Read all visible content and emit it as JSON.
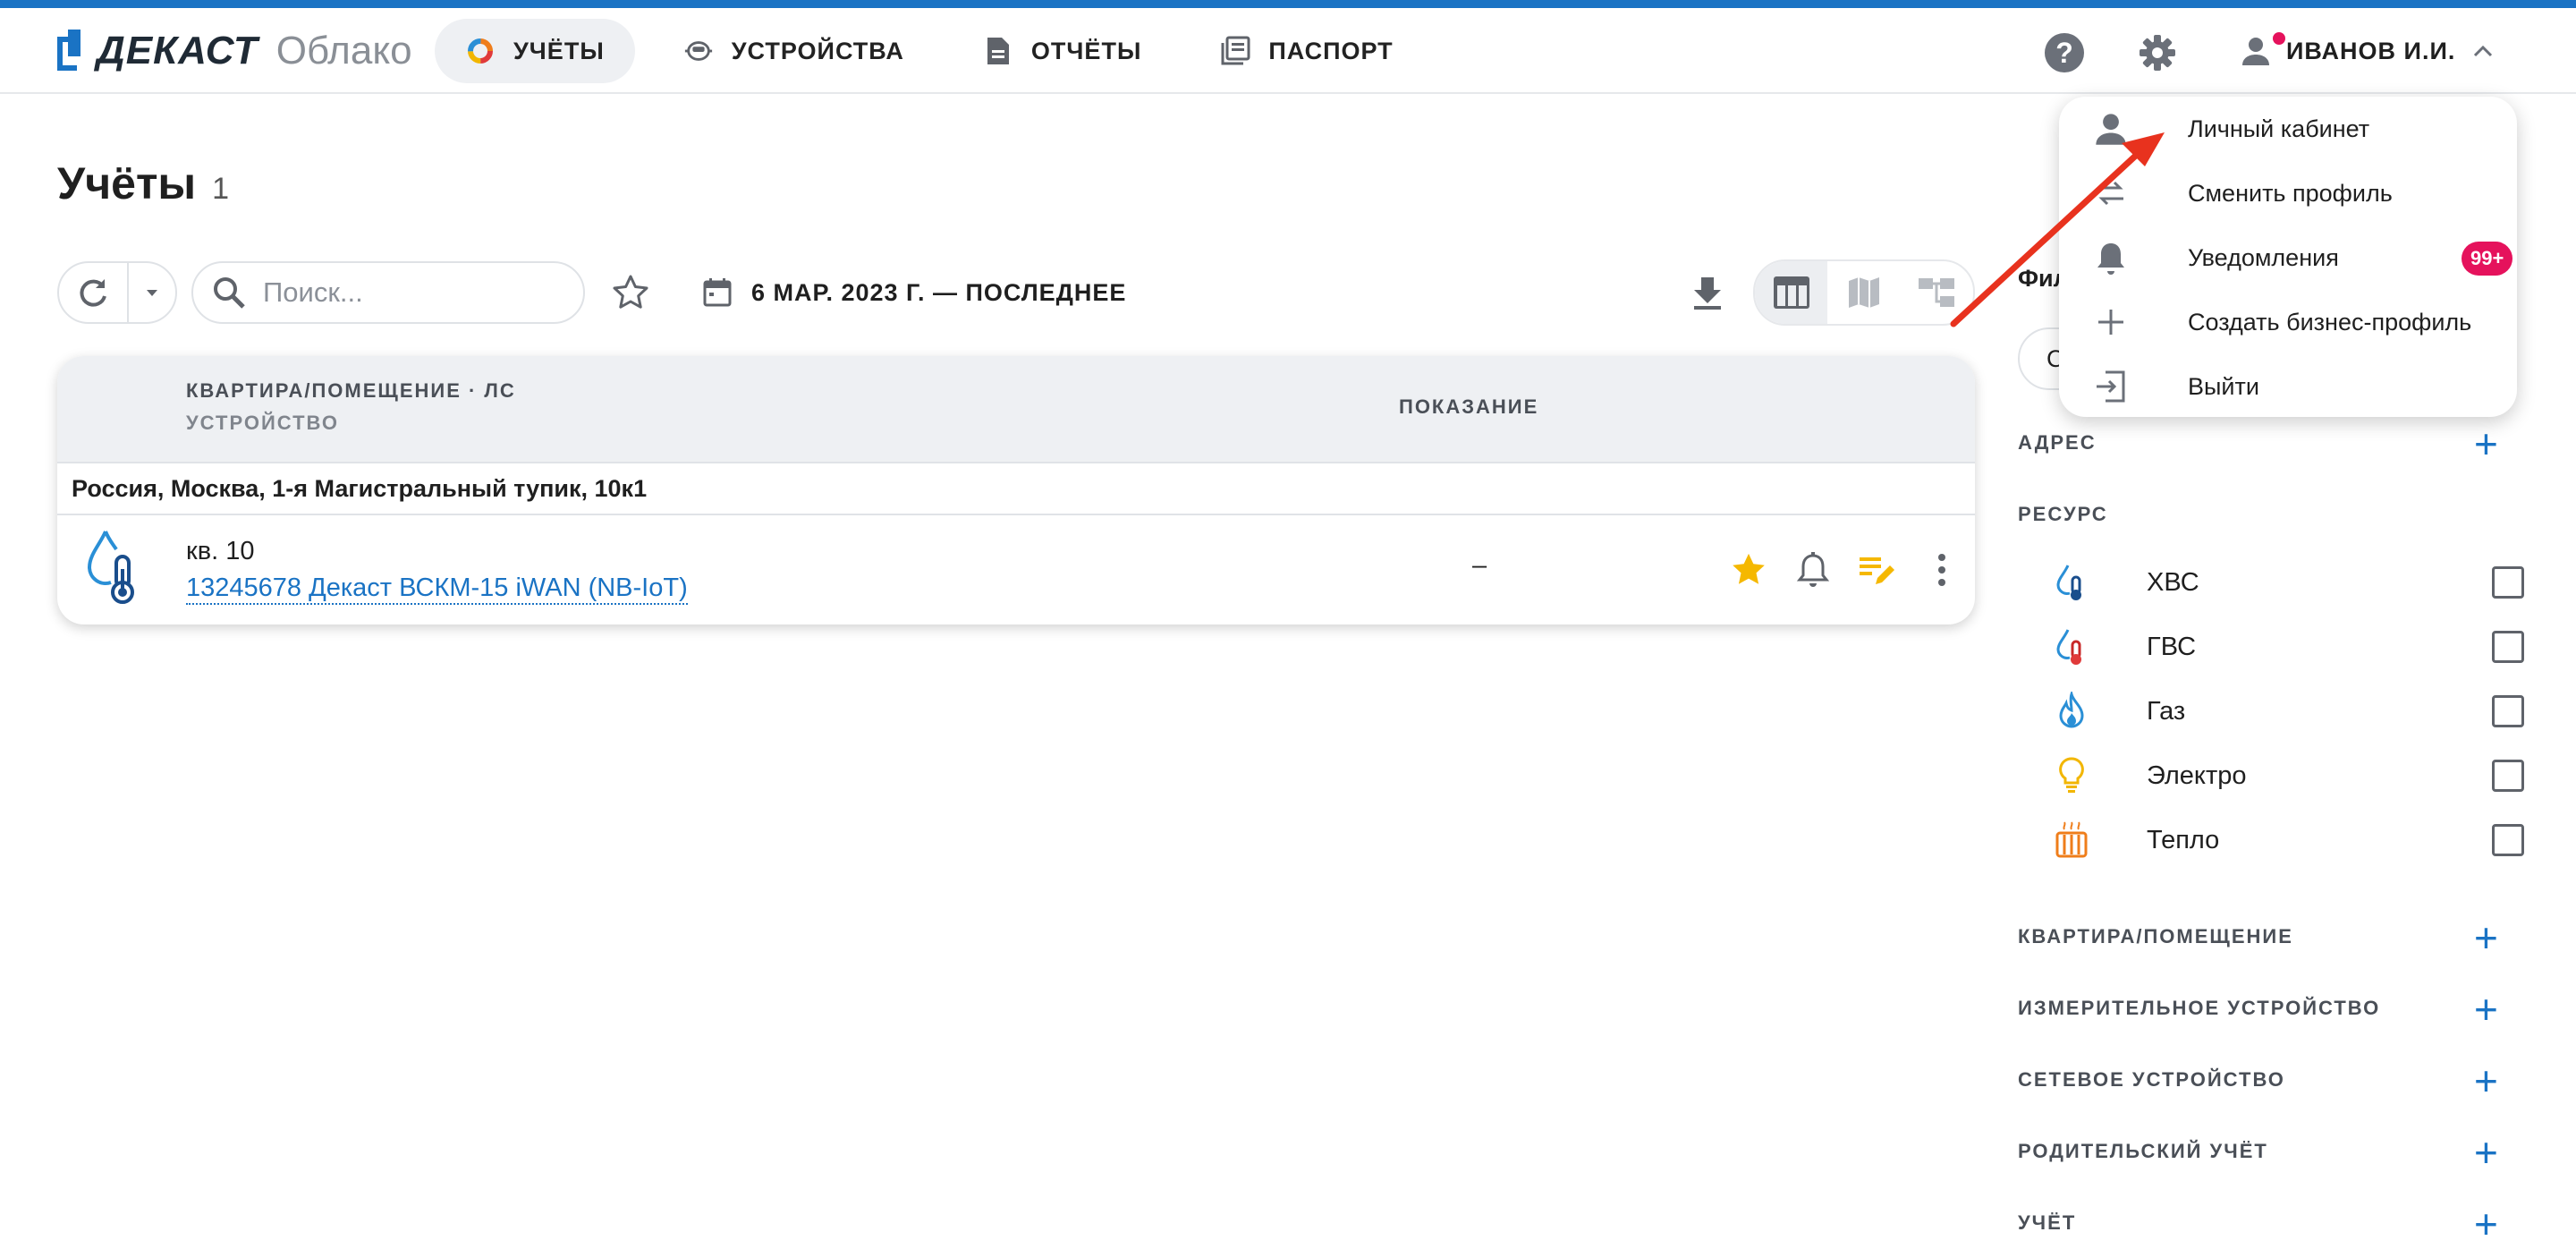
{
  "header": {
    "brand": "ДЕКАСТ",
    "brand_sub": "Облако",
    "nav": [
      {
        "label": "УЧЁТЫ",
        "icon": "pie-chart-icon",
        "active": true
      },
      {
        "label": "УСТРОЙСТВА",
        "icon": "router-icon"
      },
      {
        "label": "ОТЧЁТЫ",
        "icon": "document-icon"
      },
      {
        "label": "ПАСПОРТ",
        "icon": "library-icon"
      }
    ],
    "user_name": "ИВАНОВ И.И."
  },
  "page": {
    "title": "Учёты",
    "count": "1"
  },
  "toolbar": {
    "search_placeholder": "Поиск...",
    "date_label": "6 МАР. 2023 Г. — ПОСЛЕДНЕЕ"
  },
  "table": {
    "col_primary": "КВАРТИРА/ПОМЕЩЕНИЕ · ЛС",
    "col_secondary": "УСТРОЙСТВО",
    "col_value": "ПОКАЗАНИЕ",
    "groups": [
      {
        "address": "Россия, Москва, 1-я Магистральный тупик, 10к1",
        "rows": [
          {
            "apartment": "кв. 10",
            "device": "13245678 Декаст ВСКМ-15 iWAN (NB-IoT)",
            "value": "–",
            "resource_icon": "cold-water-icon"
          }
        ]
      }
    ]
  },
  "filters": {
    "title": "Фил",
    "chip_text": "С",
    "sections": {
      "address": "АДРЕС",
      "resource": "РЕСУРС",
      "apartment": "КВАРТИРА/ПОМЕЩЕНИЕ",
      "meter": "ИЗМЕРИТЕЛЬНОЕ УСТРОЙСТВО",
      "network": "СЕТЕВОЕ УСТРОЙСТВО",
      "parent": "РОДИТЕЛЬСКИЙ УЧЁТ",
      "account": "УЧЁТ"
    },
    "resources": [
      {
        "label": "ХВС",
        "icon": "cold-water-icon",
        "color": "#2a8fd6"
      },
      {
        "label": "ГВС",
        "icon": "hot-water-icon",
        "color": "#e03a3a"
      },
      {
        "label": "Газ",
        "icon": "gas-icon",
        "color": "#2a8fd6"
      },
      {
        "label": "Электро",
        "icon": "bulb-icon",
        "color": "#f2b600"
      },
      {
        "label": "Тепло",
        "icon": "radiator-icon",
        "color": "#ef7d1a"
      }
    ]
  },
  "user_menu": {
    "items": [
      {
        "label": "Личный кабинет",
        "icon": "person-icon"
      },
      {
        "label": "Сменить профиль",
        "icon": "swap-icon"
      },
      {
        "label": "Уведомления",
        "icon": "bell-icon",
        "badge": "99+"
      },
      {
        "label": "Создать бизнес-профиль",
        "icon": "plus-icon"
      },
      {
        "label": "Выйти",
        "icon": "logout-icon"
      }
    ]
  },
  "colors": {
    "accent": "#1a73c4",
    "badge": "#e5125c",
    "annotation_arrow": "#e8321e",
    "star": "#f5b800"
  }
}
